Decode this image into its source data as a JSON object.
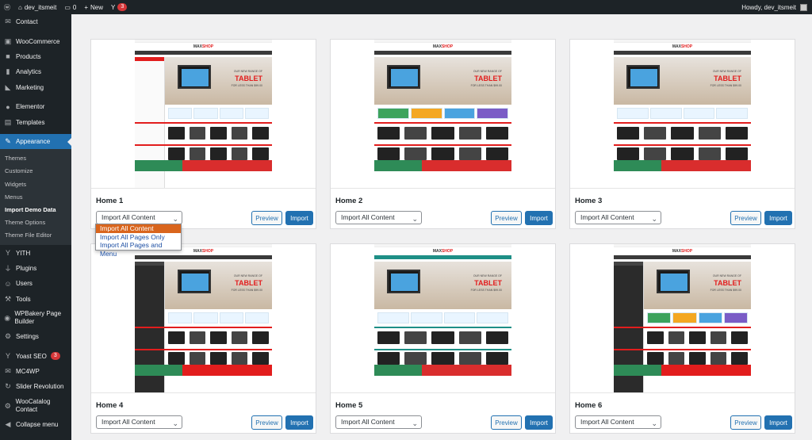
{
  "adminbar": {
    "site_name": "dev_itsmeit",
    "comments_count": "0",
    "new_label": "New",
    "yoast_badge": "3",
    "greeting": "Howdy, dev_itsmeit"
  },
  "sidebar": {
    "items_top": [
      {
        "label": "Contact",
        "icon": "envelope-icon"
      },
      {
        "label": "WooCommerce",
        "icon": "woo-icon"
      },
      {
        "label": "Products",
        "icon": "box-icon"
      },
      {
        "label": "Analytics",
        "icon": "chart-icon"
      },
      {
        "label": "Marketing",
        "icon": "megaphone-icon"
      },
      {
        "label": "Elementor",
        "icon": "elementor-icon"
      },
      {
        "label": "Templates",
        "icon": "folder-icon"
      },
      {
        "label": "Appearance",
        "icon": "brush-icon"
      }
    ],
    "submenu": [
      "Themes",
      "Customize",
      "Widgets",
      "Menus",
      "Import Demo Data",
      "Theme Options",
      "Theme File Editor"
    ],
    "items_bottom": [
      {
        "label": "YITH",
        "icon": "yith-icon"
      },
      {
        "label": "Plugins",
        "icon": "plug-icon"
      },
      {
        "label": "Users",
        "icon": "user-icon"
      },
      {
        "label": "Tools",
        "icon": "wrench-icon"
      },
      {
        "label": "WPBakery Page Builder",
        "icon": "wpbakery-icon"
      },
      {
        "label": "Settings",
        "icon": "settings-icon"
      },
      {
        "label": "Yoast SEO",
        "icon": "yoast-icon",
        "badge": "3"
      },
      {
        "label": "MC4WP",
        "icon": "mc4wp-icon"
      },
      {
        "label": "Slider Revolution",
        "icon": "refresh-icon"
      },
      {
        "label": "WooCatalog Contact",
        "icon": "catalog-icon"
      },
      {
        "label": "Collapse menu",
        "icon": "collapse-icon"
      }
    ]
  },
  "demos": [
    {
      "title": "Home 1",
      "select_value": "Import All Content",
      "preview_label": "Preview",
      "import_label": "Import"
    },
    {
      "title": "Home 2",
      "select_value": "Import All Content",
      "preview_label": "Preview",
      "import_label": "Import"
    },
    {
      "title": "Home 3",
      "select_value": "Import All Content",
      "preview_label": "Preview",
      "import_label": "Import"
    },
    {
      "title": "Home 4",
      "select_value": "Import All Content",
      "preview_label": "Preview",
      "import_label": "Import"
    },
    {
      "title": "Home 5",
      "select_value": "Import All Content",
      "preview_label": "Preview",
      "import_label": "Import"
    },
    {
      "title": "Home 6",
      "select_value": "Import All Content",
      "preview_label": "Preview",
      "import_label": "Import"
    }
  ],
  "dropdown_options": [
    "Import All Content",
    "Import All Pages Only",
    "Import All Pages and Menu"
  ],
  "mock": {
    "logo_a": "MAX",
    "logo_b": "SHOP",
    "headline_1": "OUR NEW RANGE OF",
    "headline_2": "TABLET",
    "headline_3": "FOR LESS THAN $99.00"
  },
  "colors": {
    "admin_dark": "#1d2327",
    "accent_blue": "#2271b1",
    "dropdown_highlight": "#d9651d",
    "brand_red": "#e21d1d"
  }
}
